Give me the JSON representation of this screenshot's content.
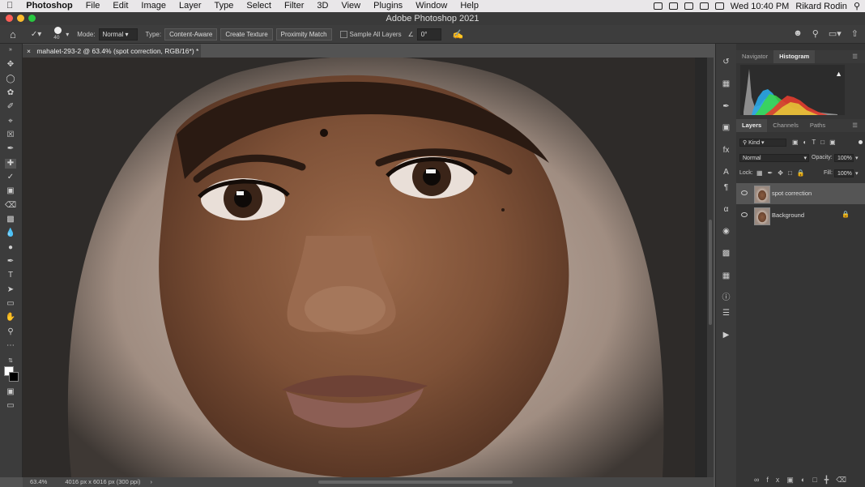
{
  "menubar": {
    "app": "Photoshop",
    "items": [
      "File",
      "Edit",
      "Image",
      "Layer",
      "Type",
      "Select",
      "Filter",
      "3D",
      "View",
      "Plugins",
      "Window",
      "Help"
    ],
    "clock": "Wed 10:40 PM",
    "user": "Rikard Rodin"
  },
  "window": {
    "title": "Adobe Photoshop 2021"
  },
  "options": {
    "brush_size": "40",
    "mode_label": "Mode:",
    "mode_value": "Normal",
    "type_label": "Type:",
    "type_buttons": [
      "Content-Aware",
      "Create Texture",
      "Proximity Match"
    ],
    "sample_all_layers": "Sample All Layers",
    "angle": "0°"
  },
  "document": {
    "tab_title": "mahalet-293-2 @ 63.4% (spot correction, RGB/16*) *",
    "zoom": "63.4%",
    "info": "4016 px x 6016 px (300 ppi)"
  },
  "panels": {
    "top_tabs": [
      "Navigator",
      "Histogram"
    ],
    "top_active": "Histogram",
    "layer_tabs": [
      "Layers",
      "Channels",
      "Paths"
    ],
    "layer_active": "Layers",
    "filter_kind": "Kind",
    "blend_mode": "Normal",
    "opacity_label": "Opacity:",
    "opacity": "100%",
    "lock_label": "Lock:",
    "fill_label": "Fill:",
    "fill": "100%",
    "layers": [
      {
        "name": "spot correction",
        "selected": true
      },
      {
        "name": "Background",
        "selected": false
      }
    ]
  },
  "colors": {
    "accent_close": "#fe5f57",
    "accent_min": "#febc2e",
    "accent_max": "#28c840"
  }
}
